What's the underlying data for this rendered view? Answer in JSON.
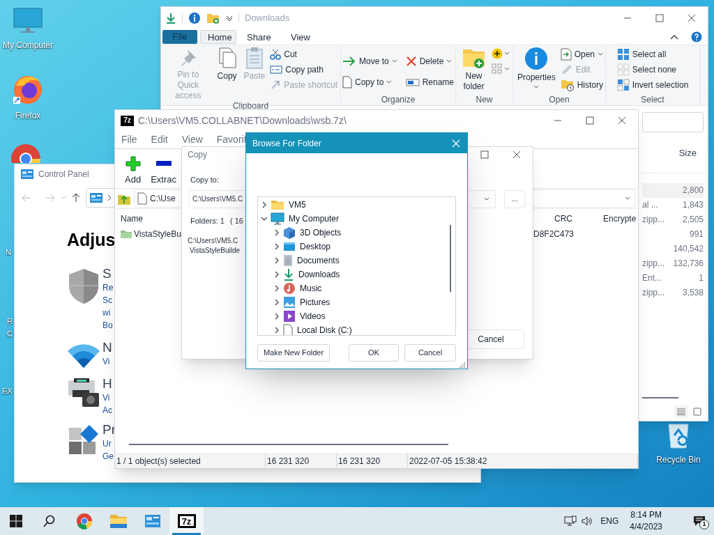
{
  "desktop": {
    "icons": [
      {
        "label": "My Computer"
      },
      {
        "label": "Firefox"
      },
      {
        "label": "Recycle Bin"
      }
    ],
    "label_fragments": [
      "N",
      "R",
      "C",
      "EX"
    ]
  },
  "explorer": {
    "title": "Downloads",
    "tabs": [
      {
        "label": "File",
        "kind": "menu",
        "selected": false
      },
      {
        "label": "Home",
        "kind": "tab",
        "selected": true
      },
      {
        "label": "Share",
        "kind": "tab",
        "selected": false
      },
      {
        "label": "View",
        "kind": "tab",
        "selected": false
      }
    ],
    "ribbon": [
      {
        "label": "Clipboard",
        "items": [
          {
            "label": "Pin to Quick access",
            "kind": "large",
            "disabled": true,
            "dropdown": false
          },
          {
            "label": "Copy",
            "kind": "large",
            "disabled": false,
            "dropdown": false
          },
          {
            "label": "Paste",
            "kind": "large",
            "disabled": true,
            "dropdown": false
          },
          {
            "label": "Cut",
            "kind": "small",
            "disabled": false,
            "dropdown": false
          },
          {
            "label": "Copy path",
            "kind": "small",
            "disabled": false,
            "dropdown": false
          },
          {
            "label": "Paste shortcut",
            "kind": "small",
            "disabled": true,
            "dropdown": false
          }
        ]
      },
      {
        "label": "Organize",
        "items": [
          {
            "label": "Move to",
            "kind": "small",
            "disabled": false,
            "dropdown": true
          },
          {
            "label": "Copy to",
            "kind": "small",
            "disabled": false,
            "dropdown": true
          },
          {
            "label": "Delete",
            "kind": "small",
            "disabled": false,
            "dropdown": true
          },
          {
            "label": "Rename",
            "kind": "small",
            "disabled": false,
            "dropdown": false
          }
        ]
      },
      {
        "label": "New",
        "items": [
          {
            "label": "New folder",
            "kind": "large",
            "disabled": false,
            "dropdown": false
          }
        ]
      },
      {
        "label": "Open",
        "items": [
          {
            "label": "Properties",
            "kind": "large",
            "disabled": false,
            "dropdown": true
          },
          {
            "label": "Open",
            "kind": "small",
            "disabled": false,
            "dropdown": true
          },
          {
            "label": "Edit",
            "kind": "small",
            "disabled": true,
            "dropdown": false
          },
          {
            "label": "History",
            "kind": "small",
            "disabled": false,
            "dropdown": false
          }
        ]
      },
      {
        "label": "Select",
        "items": [
          {
            "label": "Select all",
            "kind": "small",
            "disabled": false,
            "dropdown": false
          },
          {
            "label": "Select none",
            "kind": "small",
            "disabled": false,
            "dropdown": false
          },
          {
            "label": "Invert selection",
            "kind": "small",
            "disabled": false,
            "dropdown": false
          }
        ]
      }
    ],
    "column": "Size",
    "rows": [
      {
        "size": "2,800"
      },
      {
        "type": "al ...",
        "size": "1,843"
      },
      {
        "type": "zipp...",
        "size": "2,505"
      },
      {
        "size": "991"
      },
      {
        "size": "140,542"
      },
      {
        "type": "zipp...",
        "size": "132,736"
      },
      {
        "type": "Ent...",
        "size": "1"
      },
      {
        "type": "zipp...",
        "size": "3,538"
      }
    ]
  },
  "control_panel": {
    "title": "Control Panel",
    "heading": "Adjus",
    "categories": [
      {
        "title": "S",
        "links": [
          "Re",
          "Sc",
          "wi",
          "Bo"
        ]
      },
      {
        "title": "N",
        "links": [
          "Vi"
        ]
      },
      {
        "title": "H",
        "links": [
          "Vi",
          "Ac"
        ]
      },
      {
        "title": "Pr",
        "links": [
          "Ur",
          "Ge"
        ]
      }
    ]
  },
  "sevenzip": {
    "logo": "7z",
    "title": "C:\\Users\\VM5.COLLABNET\\Downloads\\wsb.7z\\",
    "menu": [
      "File",
      "Edit",
      "View",
      "Favorit"
    ],
    "toolbar": [
      "Add",
      "Extrac"
    ],
    "address": "C:\\Use",
    "columns": [
      "Name",
      "CRC",
      "Encrypte"
    ],
    "rows": [
      {
        "name": "VistaStyleBu",
        "crc": "D8F2C473"
      }
    ],
    "status": [
      "1 / 1 object(s) selected",
      "16 231 320",
      "16 231 320",
      "2022-07-05 15:38:42"
    ]
  },
  "copy_dialog": {
    "title": "Copy",
    "label": "Copy to:",
    "path": "C:\\Users\\VM5.C",
    "browse": "...",
    "folders": "Folders: 1",
    "size": "( 16",
    "lines": [
      "C:\\Users\\VM5.C",
      "VistaStyleBuilde"
    ],
    "cancel": "Cancel"
  },
  "browse_dialog": {
    "title": "Browse For Folder",
    "tree": [
      {
        "label": "VM5",
        "expanded": false
      },
      {
        "label": "My Computer",
        "expanded": true,
        "children": [
          {
            "label": "3D Objects",
            "expanded": false
          },
          {
            "label": "Desktop",
            "expanded": false
          },
          {
            "label": "Documents",
            "expanded": false
          },
          {
            "label": "Downloads",
            "expanded": false
          },
          {
            "label": "Music",
            "expanded": false
          },
          {
            "label": "Pictures",
            "expanded": false
          },
          {
            "label": "Videos",
            "expanded": false
          },
          {
            "label": "Local Disk (C:)",
            "expanded": false
          }
        ]
      }
    ],
    "buttons": [
      "Make New Folder",
      "OK",
      "Cancel"
    ]
  },
  "taskbar": {
    "pinned": [
      {
        "active": false
      },
      {
        "active": false
      },
      {
        "active": false
      },
      {
        "active": true,
        "logo": "7z"
      }
    ],
    "language": "ENG",
    "time": "8:14 PM",
    "date": "4/4/2023",
    "notifications": "1"
  }
}
